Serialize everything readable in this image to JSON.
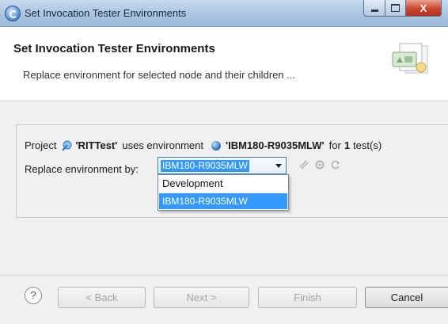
{
  "window": {
    "title": "Set Invocation Tester Environments",
    "close_glyph": "X"
  },
  "header": {
    "title": "Set Invocation Tester Environments",
    "description": "Replace environment for selected node and their children ..."
  },
  "info": {
    "prefix": "Project",
    "project_name": "'RITTest'",
    "uses_text": "uses environment",
    "environment_name": "'IBM180-R9035MLW'",
    "for_text": "for",
    "test_count": "1",
    "suffix": "test(s)"
  },
  "replace": {
    "label": "Replace environment by:",
    "selected": "IBM180-R9035MLW",
    "options": [
      "Development",
      "IBM180-R9035MLW"
    ]
  },
  "buttons": {
    "help": "?",
    "back": "< Back",
    "next": "Next >",
    "finish": "Finish",
    "cancel": "Cancel"
  },
  "colors": {
    "selection": "#3399ff",
    "title_bar": "#a9c3e0",
    "close_button": "#c9452e"
  }
}
